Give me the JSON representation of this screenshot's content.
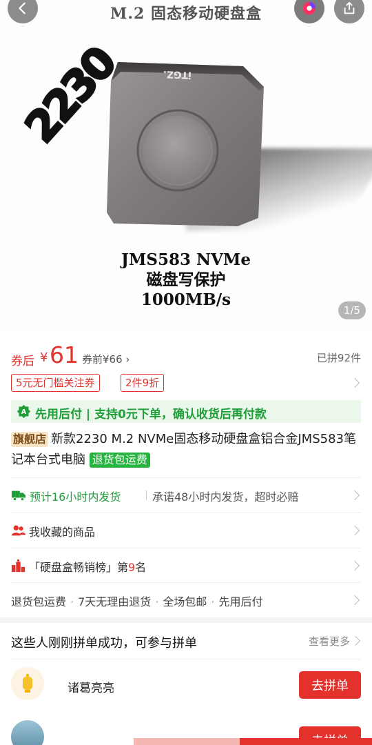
{
  "header": {
    "title": "M.2 固态移动硬盘盒",
    "back_icon": "back-arrow-icon",
    "app_icon": "app-logo-icon",
    "share_icon": "share-icon"
  },
  "hero": {
    "badge": "2230",
    "brand_text": "iTGZ.",
    "caption_line1": "JMS583 NVMe",
    "caption_line2": "磁盘写保护",
    "caption_line3": "1000MB/s",
    "page_indicator": "1/5"
  },
  "price": {
    "label": "券后",
    "currency": "¥",
    "value": "61",
    "original": "券前¥66",
    "group_count": "已拼92件"
  },
  "coupons": [
    {
      "text": "5元无门槛关注券"
    },
    {
      "text": "2件9折"
    }
  ],
  "pay_later": {
    "text": "先用后付 | 支持0元下单，确认收货后再付款"
  },
  "product": {
    "shop_tag": "旗舰店",
    "title": "新款2230 M.2 NVMe固态移动硬盘盒铝合金JMS583笔记本台式电脑",
    "return_tag": "退货包运费"
  },
  "shipping": {
    "primary": "预计16小时内发货",
    "secondary": "承诺48小时内发货，超时必赔"
  },
  "favorites": {
    "text": "我收藏的商品"
  },
  "ranking": {
    "prefix": "「硬盘盒畅销榜」第",
    "rank": "9",
    "suffix": "名"
  },
  "services": [
    "退货包运费",
    "7天无理由退货",
    "全场包邮",
    "先用后付"
  ],
  "group_buy": {
    "title": "这些人刚刚拼单成功，可参与拼单",
    "more": "查看更多",
    "members": [
      {
        "name": "诸葛亮亮",
        "button": "去拼单"
      },
      {
        "name": "",
        "button": "去拼单"
      }
    ]
  },
  "colors": {
    "accent_red": "#e3312c",
    "accent_green": "#1f9e3a"
  }
}
